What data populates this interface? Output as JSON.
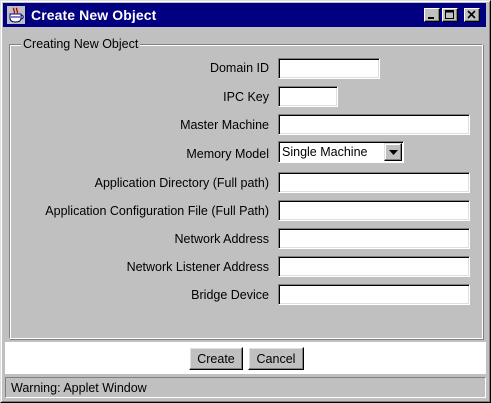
{
  "window": {
    "title": "Create New Object",
    "title_bar_color": "#000080",
    "icon": "java-coffee-cup-icon",
    "controls": {
      "minimize_icon": "minimize-icon",
      "maximize_icon": "maximize-icon",
      "close_icon": "close-icon"
    }
  },
  "form": {
    "group_title": "Creating New Object",
    "fields": [
      {
        "label": "Domain ID",
        "value": ""
      },
      {
        "label": "IPC Key",
        "value": ""
      },
      {
        "label": "Master Machine",
        "value": ""
      },
      {
        "label": "Memory Model",
        "value": "Single Machine"
      },
      {
        "label": "Application Directory (Full path)",
        "value": ""
      },
      {
        "label": "Application Configuration File (Full Path)",
        "value": ""
      },
      {
        "label": "Network Address",
        "value": ""
      },
      {
        "label": "Network Listener Address",
        "value": ""
      },
      {
        "label": "Bridge Device",
        "value": ""
      }
    ]
  },
  "buttons": {
    "create_label": "Create",
    "cancel_label": "Cancel"
  },
  "status": {
    "text": "Warning: Applet Window"
  }
}
